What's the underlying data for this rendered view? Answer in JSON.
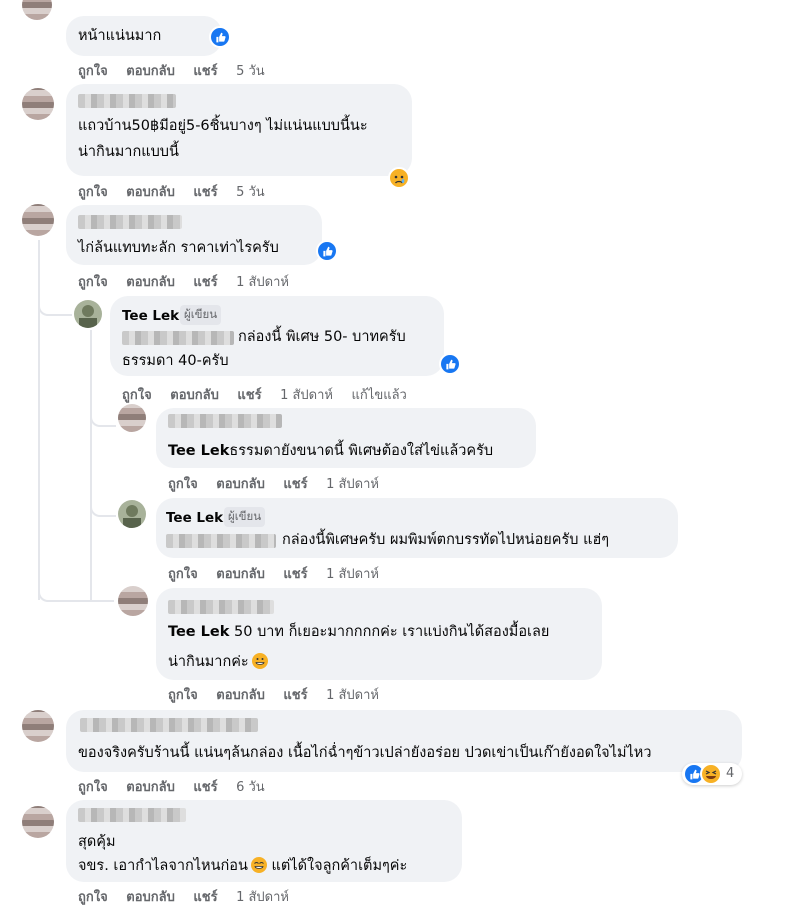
{
  "comments": [
    {
      "text": "หน้าแน่นมาก",
      "time": "5 วัน"
    },
    {
      "line1": "แถวบ้าน50฿มีอยู่5-6ชิ้นบางๆ ไม่แน่นแบบนี้นะ",
      "line2": "น่ากินมากแบบนี้",
      "time": "5 วัน"
    },
    {
      "text": "ไก่ล้นแทบทะลัก ราคาเท่าไรครับ",
      "time": "1 สัปดาห์",
      "replies": [
        {
          "name": "Tee Lek",
          "badge": "ผู้เขียน",
          "line1": "กล่องนี้ พิเศษ 50- บาทครับ",
          "line2": "ธรรมดา 40-ครับ",
          "time": "1 สัปดาห์",
          "edited": "แก้ไขแล้ว"
        },
        {
          "mention": "Tee Lek",
          "text": "ธรรมดายังขนาดนี้ พิเศษต้องใส่ไข่แล้วครับ",
          "time": "1 สัปดาห์"
        },
        {
          "name": "Tee Lek",
          "badge": "ผู้เขียน",
          "text": "กล่องนี้พิเศษครับ ผมพิมพ์ตกบรรทัดไปหน่อยครับ แฮ่ๆ",
          "time": "1 สัปดาห์"
        },
        {
          "mention": "Tee Lek",
          "line1": " 50 บาท ก็เยอะมากกกกค่ะ เราแบ่งกินได้สองมื้อเลย",
          "line2": "น่ากินมากค่ะ",
          "time": "1 สัปดาห์"
        }
      ]
    },
    {
      "text": "ของจริงครับร้านนี้ แน่นๆล้นกล่อง เนื้อไก่ฉ่ำๆข้าวเปล่ายังอร่อย ปวดเข่าเป็นเก๊ายังอดใจไม่ไหว",
      "time": "6 วัน",
      "reaction_count": "4"
    },
    {
      "line1": "สุดคุ้ม",
      "line2a": "จขร. เอากำไลจากไหนก่อน",
      "line2b": " แต่ได้ใจลูกค้าเต็มๆค่ะ",
      "time": "1 สัปดาห์"
    }
  ],
  "actions": {
    "like": "ถูกใจ",
    "reply": "ตอบกลับ",
    "share": "แชร์"
  },
  "colors": {
    "bubble": "#f0f2f5",
    "meta": "#65676b",
    "like_blue": "#1877f2"
  },
  "icons": [
    "like-icon",
    "sad-reaction-icon",
    "haha-reaction-icon",
    "grin-emoji-icon"
  ]
}
